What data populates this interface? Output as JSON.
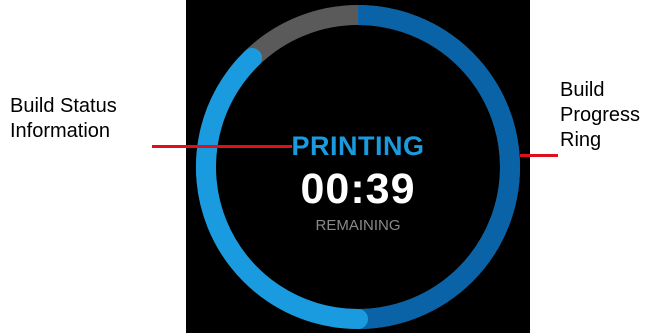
{
  "display": {
    "status": "PRINTING",
    "time_remaining": "00:39",
    "remaining_label": "REMAINING"
  },
  "progress": {
    "fraction_complete": 0.92,
    "colors": {
      "background": "#000000",
      "completed_track": "#0a63a6",
      "remaining_track": "#1a9be0",
      "pending_track": "#5a5a5a",
      "status_text": "#1a9be0",
      "time_text": "#ffffff",
      "remaining_text": "#8a8a8a",
      "leader_line": "#e0101a"
    }
  },
  "callouts": {
    "build_status": "Build Status\nInformation",
    "build_progress_ring": "Build\nProgress\nRing"
  }
}
